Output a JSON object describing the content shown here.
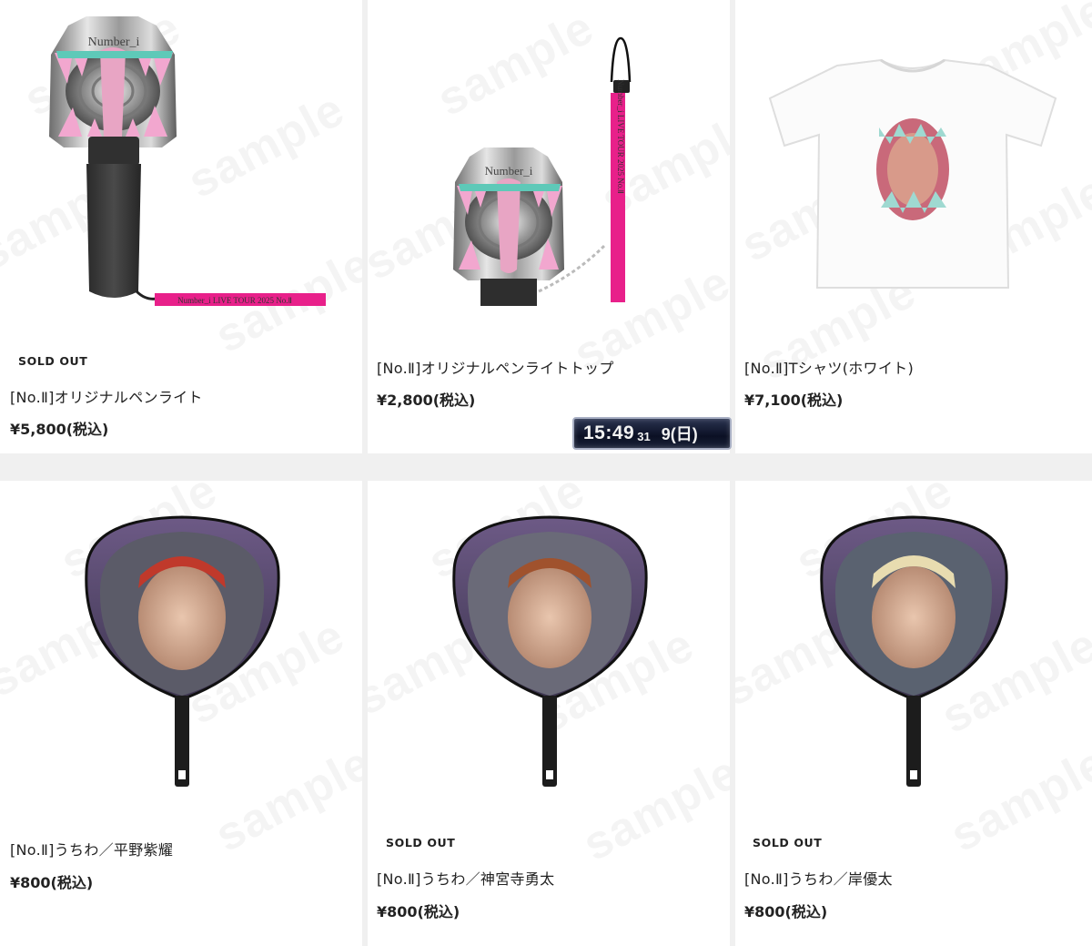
{
  "watermark": "sample",
  "clock_overlay": {
    "time": "15:49",
    "seconds": "31",
    "date": "9(日)"
  },
  "products": [
    {
      "sold_out": "SOLD OUT",
      "title": "[No.Ⅱ]オリジナルペンライト",
      "price": "¥5,800(税込)",
      "image": "penlight-product-image"
    },
    {
      "sold_out": "",
      "title": "[No.Ⅱ]オリジナルペンライトトップ",
      "price": "¥2,800(税込)",
      "image": "penlight-top-product-image"
    },
    {
      "sold_out": "",
      "title": "[No.Ⅱ]Tシャツ(ホワイト)",
      "price": "¥7,100(税込)",
      "image": "tshirt-product-image"
    },
    {
      "sold_out": "",
      "title": "[No.Ⅱ]うちわ／平野紫耀",
      "price": "¥800(税込)",
      "image": "uchiwa-fan-product-image"
    },
    {
      "sold_out": "SOLD OUT",
      "title": "[No.Ⅱ]うちわ／神宮寺勇太",
      "price": "¥800(税込)",
      "image": "uchiwa-fan-product-image"
    },
    {
      "sold_out": "SOLD OUT",
      "title": "[No.Ⅱ]うちわ／岸優太",
      "price": "¥800(税込)",
      "image": "uchiwa-fan-product-image"
    }
  ],
  "product_printed_text": {
    "penlight_head": "Number_i",
    "lanyard": "Number_i LIVE TOUR 2025 No.Ⅱ"
  },
  "colors": {
    "accent_pink": "#e8208a",
    "teal": "#5ec9b8",
    "price_text": "#222222",
    "page_bg": "#f0f0f0"
  }
}
